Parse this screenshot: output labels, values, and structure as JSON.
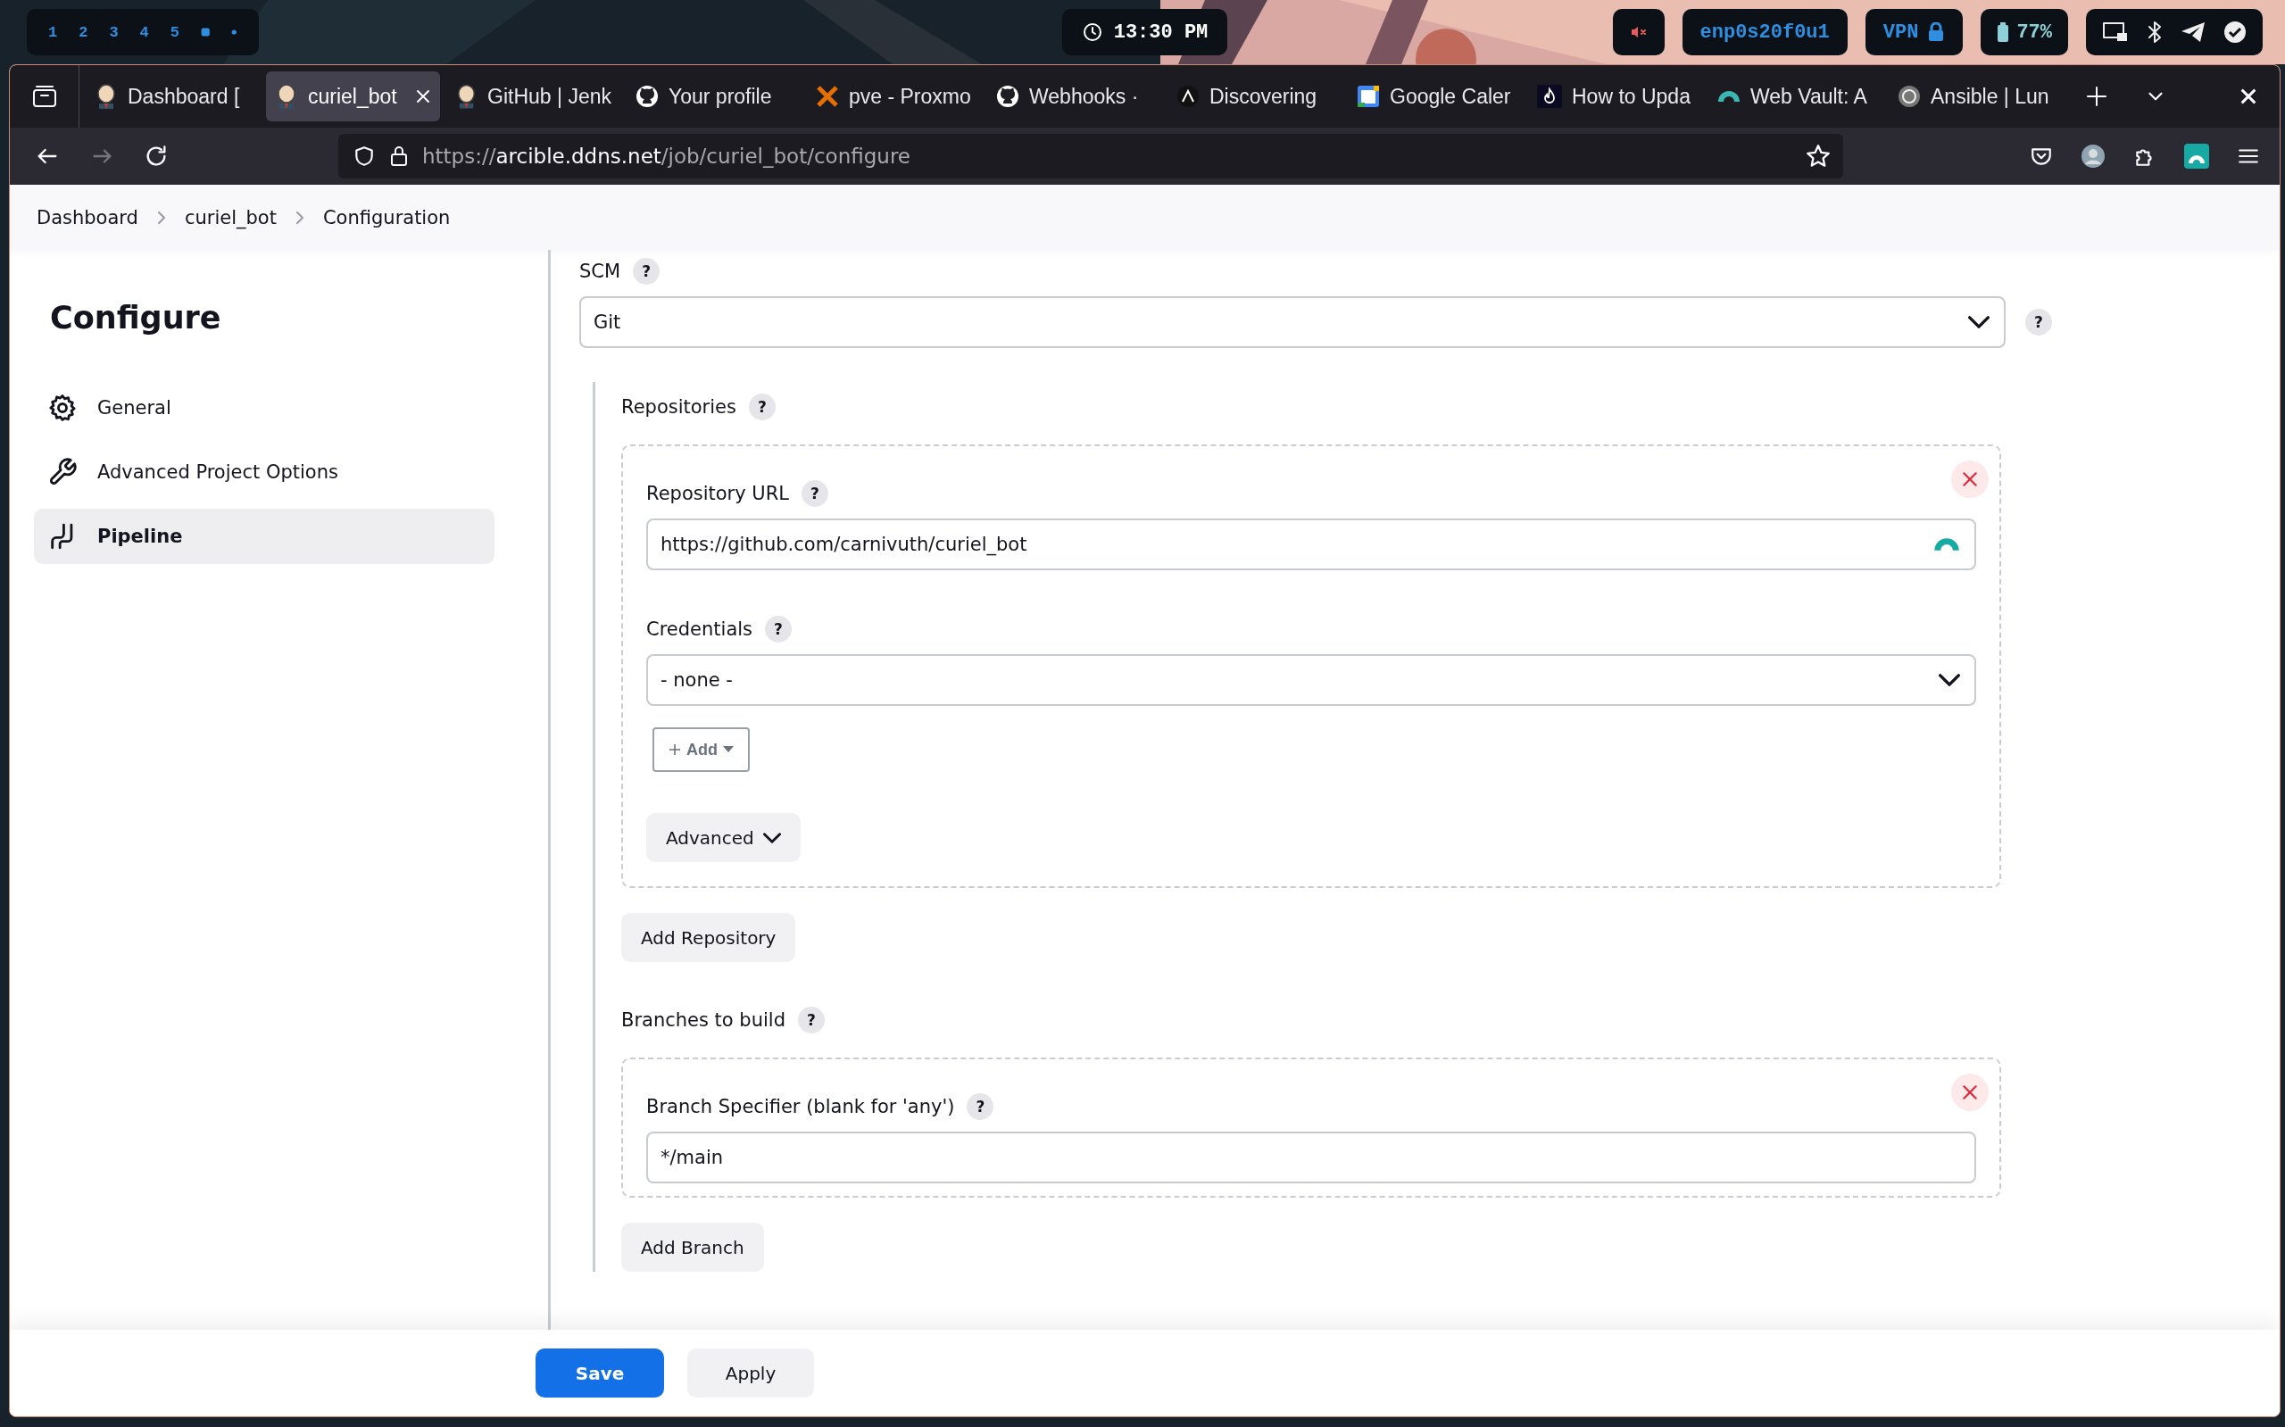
{
  "system_bar": {
    "workspaces": [
      "1",
      "2",
      "3",
      "4",
      "5"
    ],
    "clock": "13:30 PM",
    "network": "enp0s20f0u1",
    "vpn": "VPN",
    "battery": "77%"
  },
  "browser": {
    "tabs": [
      {
        "title": "Dashboard [",
        "kind": "jenkins",
        "selected": false
      },
      {
        "title": "curiel_bot",
        "kind": "jenkins",
        "selected": true
      },
      {
        "title": "GitHub | Jenk",
        "kind": "jenkins",
        "selected": false
      },
      {
        "title": "Your profile",
        "kind": "github",
        "selected": false
      },
      {
        "title": "pve - Proxmo",
        "kind": "proxmox",
        "selected": false
      },
      {
        "title": "Webhooks ·",
        "kind": "github",
        "selected": false
      },
      {
        "title": "Discovering",
        "kind": "letter",
        "selected": false
      },
      {
        "title": "Google Caler",
        "kind": "calendar",
        "selected": false
      },
      {
        "title": "How to Upda",
        "kind": "flame",
        "selected": false
      },
      {
        "title": "Web Vault: A",
        "kind": "vault",
        "selected": false
      },
      {
        "title": "Ansible | Lun",
        "kind": "ansible",
        "selected": false
      }
    ],
    "url": {
      "scheme": "https://",
      "host": "arcible.ddns.net",
      "path": "/job/curiel_bot/configure"
    }
  },
  "breadcrumbs": [
    "Dashboard",
    "curiel_bot",
    "Configuration"
  ],
  "sidebar": {
    "title": "Configure",
    "items": [
      {
        "label": "General",
        "kind": "gear",
        "selected": false
      },
      {
        "label": "Advanced Project Options",
        "kind": "wrench",
        "selected": false
      },
      {
        "label": "Pipeline",
        "kind": "pipeline",
        "selected": true
      }
    ]
  },
  "form": {
    "scm": {
      "label": "SCM",
      "help": "?",
      "value": "Git",
      "side_help": "?"
    },
    "repositories": {
      "label": "Repositories",
      "help": "?",
      "items": [
        {
          "url_label": "Repository URL",
          "url_help": "?",
          "url": "https://github.com/carnivuth/curiel_bot",
          "credentials_label": "Credentials",
          "credentials_help": "?",
          "credentials": "- none -",
          "add": "Add",
          "advanced": "Advanced"
        }
      ],
      "add_button": "Add Repository"
    },
    "branches": {
      "label": "Branches to build",
      "help": "?",
      "items": [
        {
          "label": "Branch Specifier (blank for 'any')",
          "help": "?",
          "value": "*/main"
        }
      ],
      "add_button": "Add Branch"
    }
  },
  "actions": {
    "save": "Save",
    "apply": "Apply"
  }
}
